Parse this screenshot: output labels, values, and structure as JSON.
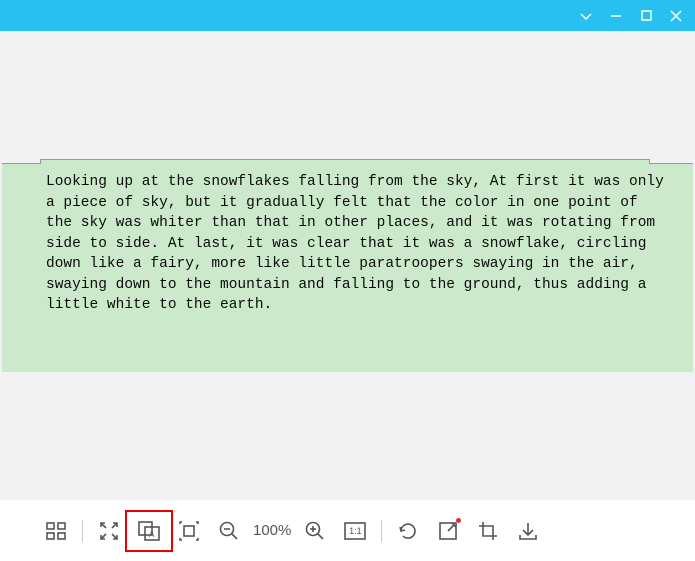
{
  "document": {
    "text": "Looking up at the snowflakes falling from the sky, At first it was only a piece of sky, but it gradually felt that the color in one point of the sky was whiter than that in other places, and it was rotating from side to side. At last, it was clear that it was a snowflake, circling down like a fairy, more like little paratroopers swaying in the air, swaying down to the mountain and falling to the ground, thus adding a little white to the earth."
  },
  "toolbar": {
    "zoom_level": "100%",
    "actual_size_label": "1:1"
  },
  "window": {
    "accent_color": "#28c0f0"
  }
}
